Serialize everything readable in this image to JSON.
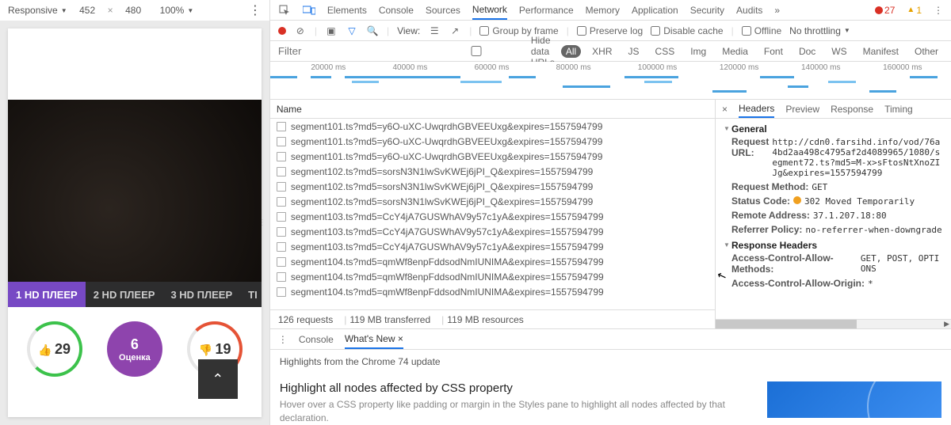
{
  "device_toolbar": {
    "mode": "Responsive",
    "width": "452",
    "height": "480",
    "zoom": "100%"
  },
  "viewport": {
    "hd_tabs": [
      {
        "label": "1 HD ПЛЕЕР",
        "active": true
      },
      {
        "label": "2 HD ПЛЕЕР",
        "active": false
      },
      {
        "label": "3 HD ПЛЕЕР",
        "active": false
      },
      {
        "label": "TI",
        "active": false
      }
    ],
    "likes": "29",
    "dislikes": "19",
    "score_big": "6",
    "score_label": "Оценка"
  },
  "devtools": {
    "tabs": [
      "Elements",
      "Console",
      "Sources",
      "Network",
      "Performance",
      "Memory",
      "Application",
      "Security",
      "Audits"
    ],
    "active_tab": "Network",
    "errors": "27",
    "warnings": "1",
    "netbar": {
      "view_label": "View:",
      "group_by_frame": "Group by frame",
      "preserve_log": "Preserve log",
      "disable_cache": "Disable cache",
      "offline": "Offline",
      "throttling": "No throttling"
    },
    "filter": {
      "placeholder": "Filter",
      "hide_data_urls": "Hide data URLs",
      "pills": [
        "All",
        "XHR",
        "JS",
        "CSS",
        "Img",
        "Media",
        "Font",
        "Doc",
        "WS",
        "Manifest",
        "Other"
      ],
      "active_pill": "All"
    },
    "timeline_ticks": [
      "20000 ms",
      "40000 ms",
      "60000 ms",
      "80000 ms",
      "100000 ms",
      "120000 ms",
      "140000 ms",
      "160000 ms"
    ],
    "name_header": "Name",
    "requests": [
      "segment101.ts?md5=y6O-uXC-UwqrdhGBVEEUxg&expires=1557594799",
      "segment101.ts?md5=y6O-uXC-UwqrdhGBVEEUxg&expires=1557594799",
      "segment101.ts?md5=y6O-uXC-UwqrdhGBVEEUxg&expires=1557594799",
      "segment102.ts?md5=sorsN3N1lwSvKWEj6jPI_Q&expires=1557594799",
      "segment102.ts?md5=sorsN3N1lwSvKWEj6jPI_Q&expires=1557594799",
      "segment102.ts?md5=sorsN3N1lwSvKWEj6jPI_Q&expires=1557594799",
      "segment103.ts?md5=CcY4jA7GUSWhAV9y57c1yA&expires=1557594799",
      "segment103.ts?md5=CcY4jA7GUSWhAV9y57c1yA&expires=1557594799",
      "segment103.ts?md5=CcY4jA7GUSWhAV9y57c1yA&expires=1557594799",
      "segment104.ts?md5=qmWf8enpFddsodNmIUNIMA&expires=1557594799",
      "segment104.ts?md5=qmWf8enpFddsodNmIUNIMA&expires=1557594799",
      "segment104.ts?md5=qmWf8enpFddsodNmIUNIMA&expires=1557594799"
    ],
    "status_summary": {
      "requests": "126 requests",
      "transferred": "119 MB transferred",
      "resources": "119 MB resources"
    },
    "detail_tabs": [
      "Headers",
      "Preview",
      "Response",
      "Timing"
    ],
    "detail_active": "Headers",
    "headers": {
      "general_label": "General",
      "request_url_k": "Request URL:",
      "request_url_v": "http://cdn0.farsihd.info/vod/76a4bd2aa498c4795af2d4089965/1080/segment72.ts?md5=M-x>sFtosNtXnoZIJg&expires=1557594799",
      "request_method_k": "Request Method:",
      "request_method_v": "GET",
      "status_code_k": "Status Code:",
      "status_code_v": "302 Moved Temporarily",
      "remote_address_k": "Remote Address:",
      "remote_address_v": "37.1.207.18:80",
      "referrer_policy_k": "Referrer Policy:",
      "referrer_policy_v": "no-referrer-when-downgrade",
      "response_headers_label": "Response Headers",
      "ac_methods_k": "Access-Control-Allow-Methods:",
      "ac_methods_v": "GET, POST, OPTIONS",
      "ac_origin_k": "Access-Control-Allow-Origin:",
      "ac_origin_v": "*"
    },
    "drawer": {
      "tabs": [
        "Console",
        "What's New"
      ],
      "active": "What's New",
      "highlights_line": "Highlights from the Chrome 74 update",
      "hero_title": "Highlight all nodes affected by CSS property",
      "hero_body": "Hover over a CSS property like padding or margin in the Styles pane to highlight all nodes affected by that declaration."
    }
  }
}
